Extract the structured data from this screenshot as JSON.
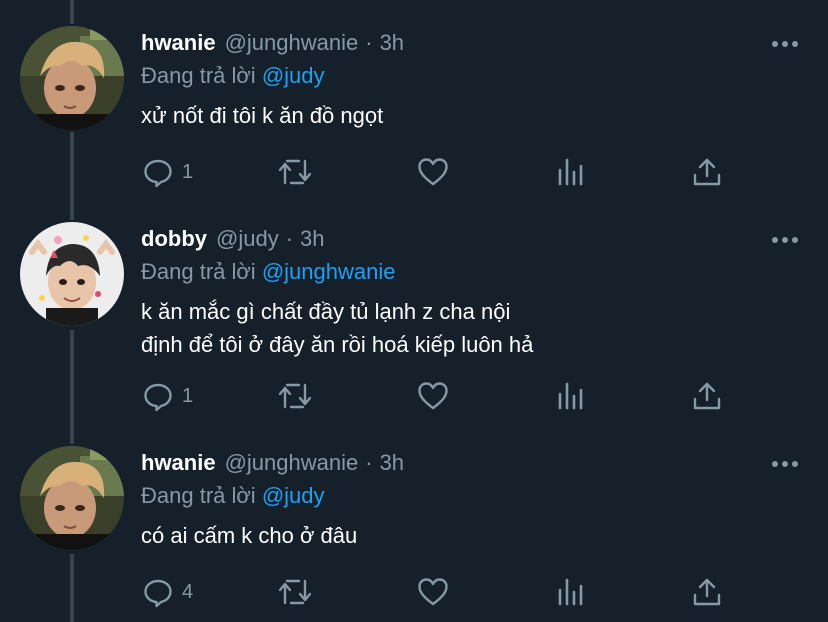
{
  "tweets": [
    {
      "name": "hwanie",
      "handle": "@junghwanie",
      "dot": "·",
      "time": "3h",
      "reply_prefix": "Đang trả lời",
      "reply_to": "@judy",
      "text_lines": [
        "xử nốt đi tôi k ăn đồ ngọt"
      ],
      "reply_count": "1",
      "avatar": "avatar-hwanie"
    },
    {
      "name": "dobby",
      "handle": "@judy",
      "dot": "·",
      "time": "3h",
      "reply_prefix": "Đang trả lời",
      "reply_to": "@junghwanie",
      "text_lines": [
        "k ăn mắc gì chất đầy tủ lạnh z cha nội",
        "định để tôi ở đây ăn rồi hoá kiếp luôn hả"
      ],
      "reply_count": "1",
      "avatar": "avatar-dobby"
    },
    {
      "name": "hwanie",
      "handle": "@junghwanie",
      "dot": "·",
      "time": "3h",
      "reply_prefix": "Đang trả lời",
      "reply_to": "@judy",
      "text_lines": [
        "có ai cấm k cho ở đâu"
      ],
      "reply_count": "4",
      "avatar": "avatar-hwanie"
    }
  ],
  "colors": {
    "background": "#15202b",
    "secondary_text": "#8899a6",
    "mention": "#1da1f2",
    "thread_line": "#38444d"
  },
  "icons": [
    "reply-icon",
    "retweet-icon",
    "like-icon",
    "analytics-icon",
    "share-icon",
    "more-icon"
  ]
}
